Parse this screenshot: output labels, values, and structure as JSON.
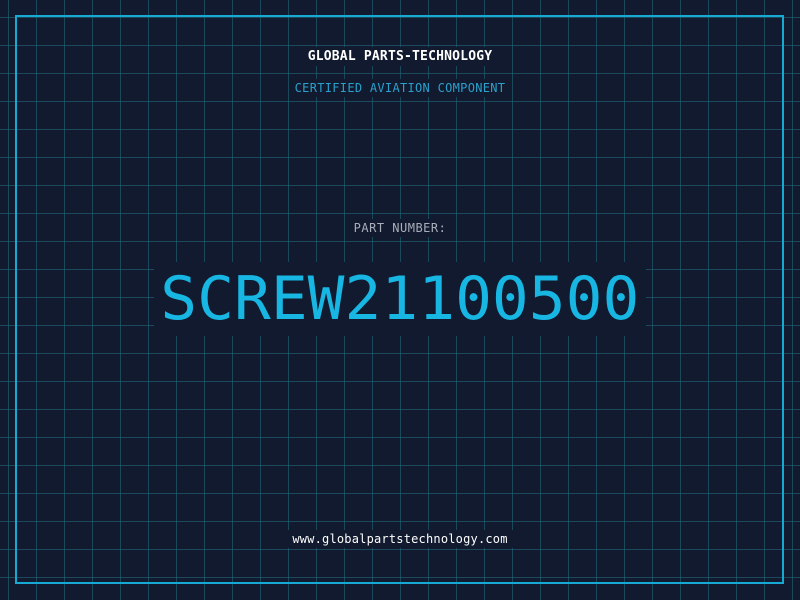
{
  "header": {
    "company": "GLOBAL PARTS-TECHNOLOGY",
    "subtitle": "CERTIFIED AVIATION COMPONENT"
  },
  "part": {
    "label": "PART NUMBER:",
    "number": "SCREW21100500"
  },
  "footer": {
    "url": "www.globalpartstechnology.com"
  },
  "colors": {
    "background": "#111a2e",
    "grid": "#246e82",
    "accent": "#17b6e3",
    "frame": "#17a9d3",
    "title": "#ffffff",
    "label": "#a8aeb9"
  }
}
